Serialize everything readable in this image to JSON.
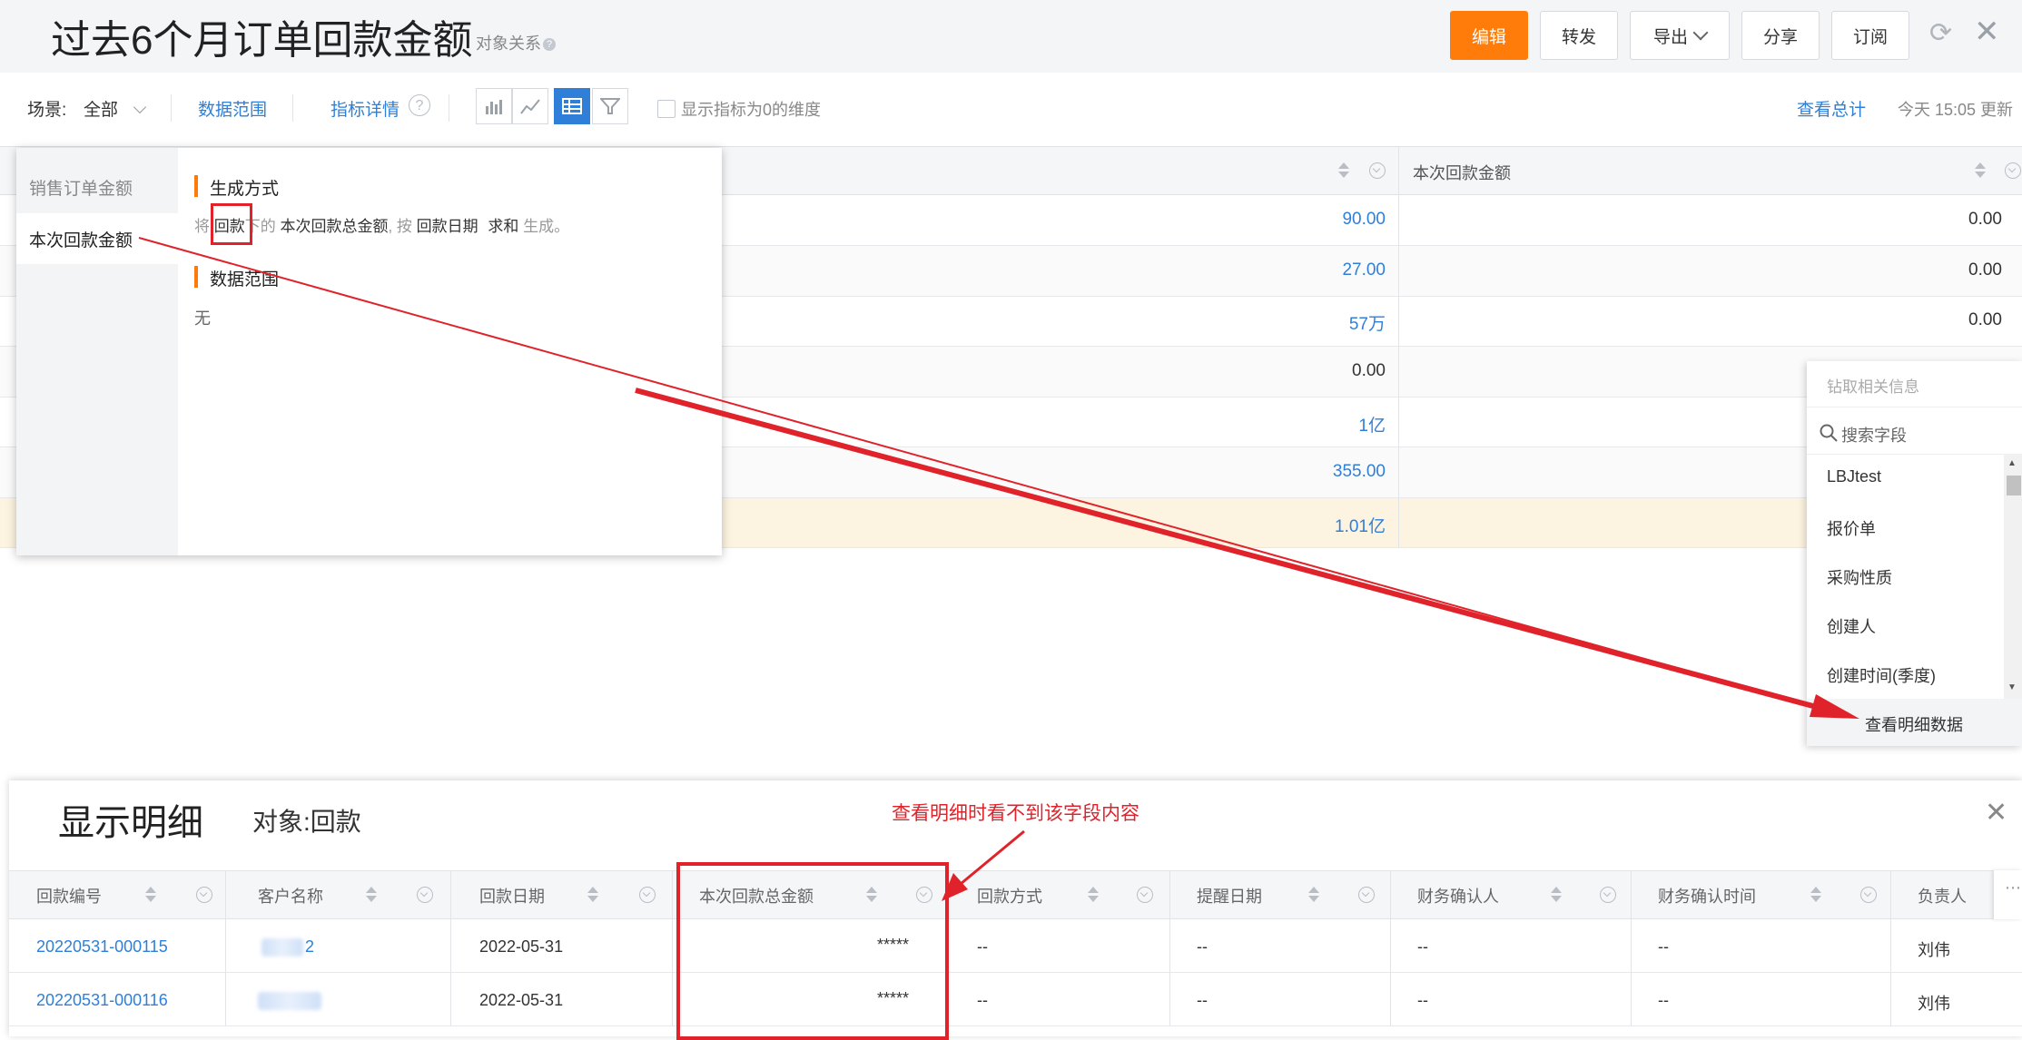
{
  "header": {
    "title": "过去6个月订单回款金额",
    "object_relation": "对象关系",
    "buttons": {
      "edit": "编辑",
      "forward": "转发",
      "export": "导出",
      "share": "分享",
      "subscribe": "订阅"
    }
  },
  "toolbar": {
    "scene_label": "场景:",
    "scene_value": "全部",
    "data_range": "数据范围",
    "metric_detail": "指标详情",
    "show_zero_dims": "显示指标为0的维度",
    "view_total": "查看总计",
    "updated": "今天 15:05 更新"
  },
  "table": {
    "col2_header": "本次回款金额",
    "rows": [
      {
        "a": "90.00",
        "b": "0.00"
      },
      {
        "a": "27.00",
        "b": "0.00"
      },
      {
        "a": "57万",
        "b": "0.00"
      },
      {
        "a": "0.00",
        "b": ""
      },
      {
        "a": "1亿",
        "b": ""
      },
      {
        "a": "355.00",
        "b": ""
      },
      {
        "a": "1.01亿",
        "b": ""
      }
    ]
  },
  "popover": {
    "metrics": [
      "销售订单金额",
      "本次回款金额"
    ],
    "gen_title": "生成方式",
    "gen_desc": {
      "p1": "将",
      "obj": "回款",
      "p2": "下的",
      "field": "本次回款总金额",
      "p3": ", 按",
      "date": "回款日期",
      "agg": "求和",
      "p4": "生成。"
    },
    "range_title": "数据范围",
    "range_value": "无"
  },
  "drill": {
    "title": "钻取相关信息",
    "search_placeholder": "搜索字段",
    "items": [
      "LBJtest",
      "报价单",
      "采购性质",
      "创建人",
      "创建时间(季度)"
    ],
    "view_detail": "查看明细数据"
  },
  "detail": {
    "title": "显示明细",
    "object": "对象:回款",
    "annotation": "查看明细时看不到该字段内容",
    "columns": [
      "回款编号",
      "客户名称",
      "回款日期",
      "本次回款总金额",
      "回款方式",
      "提醒日期",
      "财务确认人",
      "财务确认时间",
      "负责人"
    ],
    "rows": [
      {
        "no": "20220531-000115",
        "customer_suffix": "2",
        "date": "2022-05-31",
        "amount": "*****",
        "method": "--",
        "remind": "--",
        "confirmer": "--",
        "confirm_time": "--",
        "owner": "刘伟"
      },
      {
        "no": "20220531-000116",
        "customer_suffix": "",
        "date": "2022-05-31",
        "amount": "*****",
        "method": "--",
        "remind": "--",
        "confirmer": "--",
        "confirm_time": "--",
        "owner": "刘伟"
      }
    ]
  },
  "colors": {
    "accent": "#ff7c0a",
    "link": "#2f7fd8",
    "annotation": "#e0222a"
  }
}
